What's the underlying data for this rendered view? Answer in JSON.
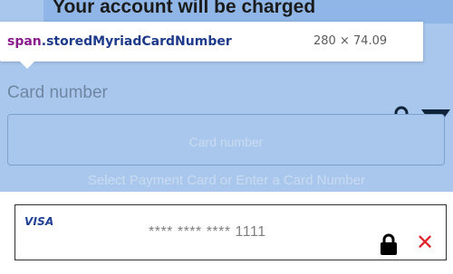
{
  "header": {
    "charged_text": "Your account will be charged"
  },
  "devtools_tooltip": {
    "tag": "span",
    "class_name": ".storedMyriadCardNumber",
    "dimensions": "280 × 74.09"
  },
  "form": {
    "label": "Card number",
    "input_placeholder": "Card number",
    "hint": "Select Payment Card or Enter a Card Number",
    "stored_card": {
      "brand": "VISA",
      "masked_number": "**** **** **** 1111"
    }
  },
  "icons": {
    "lock": "lock-icon",
    "dropdown": "chevron-down-icon",
    "remove": "close-icon"
  },
  "colors": {
    "overlay": "#a9c7ec",
    "visa_blue": "#1f3f95",
    "remove_red": "#e0252c"
  }
}
